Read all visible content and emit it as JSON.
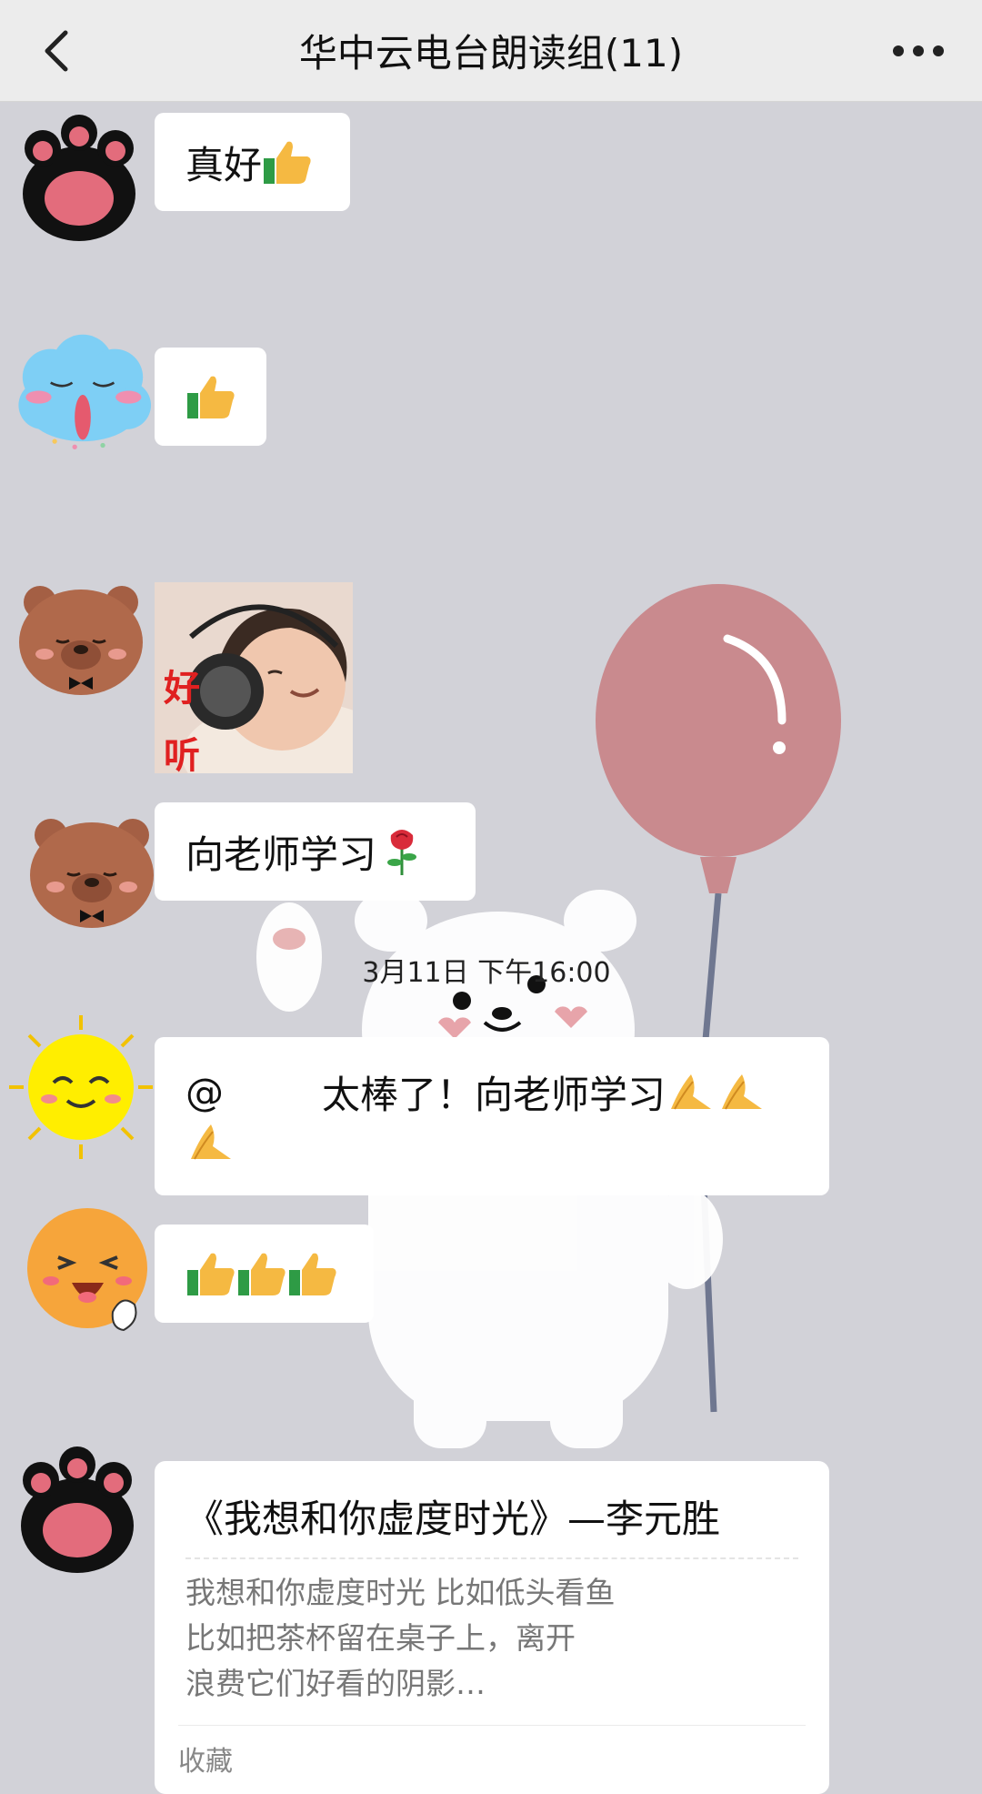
{
  "header": {
    "title": "华中云电台朗读组(11)"
  },
  "messages": [
    {
      "text": "真好"
    },
    {
      "text": ""
    },
    {
      "sticker_caption": [
        "好",
        "听"
      ]
    },
    {
      "text": "向老师学习"
    },
    {
      "text": "@",
      "text_main": "太棒了！向老师学习"
    },
    {
      "text": ""
    }
  ],
  "timestamp": "3月11日 下午16:00",
  "share_card": {
    "title": "《我想和你虚度时光》—李元胜",
    "lines": [
      "我想和你虚度时光 比如低头看鱼",
      "比如把茶杯留在桌子上，离开",
      "浪费它们好看的阴影…"
    ],
    "source": "收藏"
  },
  "colors": {
    "background": "#d2d2d8",
    "header": "#ececec",
    "bubble": "#ffffff",
    "balloon": "#c98a8e"
  },
  "icons": [
    "back-icon",
    "more-icon",
    "thumbs-up-icon",
    "rose-icon",
    "praying-hands-icon"
  ]
}
